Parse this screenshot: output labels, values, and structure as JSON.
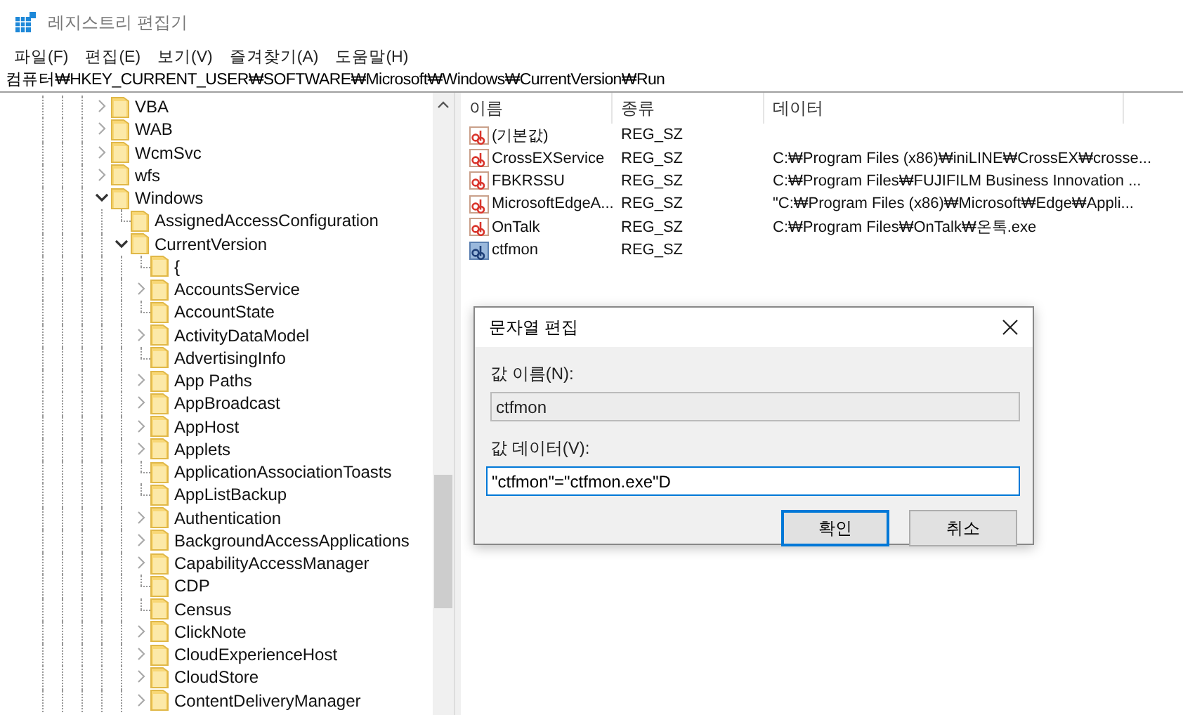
{
  "window": {
    "title": "레지스트리 편집기"
  },
  "menu": [
    "파일(F)",
    "편집(E)",
    "보기(V)",
    "즐겨찾기(A)",
    "도움말(H)"
  ],
  "address": "컴퓨터₩HKEY_CURRENT_USER₩SOFTWARE₩Microsoft₩Windows₩CurrentVersion₩Run",
  "tree": [
    {
      "label": "VBA",
      "expandable": true,
      "expanded": false
    },
    {
      "label": "WAB",
      "expandable": true,
      "expanded": false
    },
    {
      "label": "WcmSvc",
      "expandable": true,
      "expanded": false
    },
    {
      "label": "wfs",
      "expandable": true,
      "expanded": false
    },
    {
      "label": "Windows",
      "expandable": true,
      "expanded": true,
      "children": [
        {
          "label": "AssignedAccessConfiguration",
          "expandable": false
        },
        {
          "label": "CurrentVersion",
          "expandable": true,
          "expanded": true,
          "children": [
            {
              "label": "{",
              "expandable": false
            },
            {
              "label": "AccountsService",
              "expandable": true,
              "expanded": false
            },
            {
              "label": "AccountState",
              "expandable": false
            },
            {
              "label": "ActivityDataModel",
              "expandable": true,
              "expanded": false
            },
            {
              "label": "AdvertisingInfo",
              "expandable": false
            },
            {
              "label": "App Paths",
              "expandable": true,
              "expanded": false
            },
            {
              "label": "AppBroadcast",
              "expandable": true,
              "expanded": false
            },
            {
              "label": "AppHost",
              "expandable": true,
              "expanded": false
            },
            {
              "label": "Applets",
              "expandable": true,
              "expanded": false
            },
            {
              "label": "ApplicationAssociationToasts",
              "expandable": false
            },
            {
              "label": "AppListBackup",
              "expandable": false
            },
            {
              "label": "Authentication",
              "expandable": true,
              "expanded": false
            },
            {
              "label": "BackgroundAccessApplications",
              "expandable": true,
              "expanded": false
            },
            {
              "label": "CapabilityAccessManager",
              "expandable": true,
              "expanded": false
            },
            {
              "label": "CDP",
              "expandable": false
            },
            {
              "label": "Census",
              "expandable": false
            },
            {
              "label": "ClickNote",
              "expandable": true,
              "expanded": false
            },
            {
              "label": "CloudExperienceHost",
              "expandable": true,
              "expanded": false
            },
            {
              "label": "CloudStore",
              "expandable": true,
              "expanded": false
            },
            {
              "label": "ContentDeliveryManager",
              "expandable": true,
              "expanded": false
            }
          ]
        }
      ]
    }
  ],
  "list": {
    "columns": [
      "이름",
      "종류",
      "데이터"
    ],
    "rows": [
      {
        "name": "(기본값)",
        "type": "REG_SZ",
        "data": "",
        "selected": false
      },
      {
        "name": "CrossEXService",
        "type": "REG_SZ",
        "data": "C:₩Program Files (x86)₩iniLINE₩CrossEX₩crosse...",
        "selected": false
      },
      {
        "name": "FBKRSSU",
        "type": "REG_SZ",
        "data": "C:₩Program Files₩FUJIFILM Business Innovation ...",
        "selected": false
      },
      {
        "name": "MicrosoftEdgeA...",
        "type": "REG_SZ",
        "data": "\"C:₩Program Files (x86)₩Microsoft₩Edge₩Appli...",
        "selected": false
      },
      {
        "name": "OnTalk",
        "type": "REG_SZ",
        "data": "C:₩Program Files₩OnTalk₩온톡.exe",
        "selected": false
      },
      {
        "name": "ctfmon",
        "type": "REG_SZ",
        "data": "",
        "selected": true
      }
    ]
  },
  "dialog": {
    "title": "문자열 편집",
    "name_label": "값 이름(N):",
    "name_value": "ctfmon",
    "data_label": "값 데이터(V):",
    "data_value": "\"ctfmon\"=\"ctfmon.exe\"D",
    "buttons": [
      {
        "label": "확인",
        "default": true
      },
      {
        "label": "취소",
        "default": false
      }
    ]
  }
}
